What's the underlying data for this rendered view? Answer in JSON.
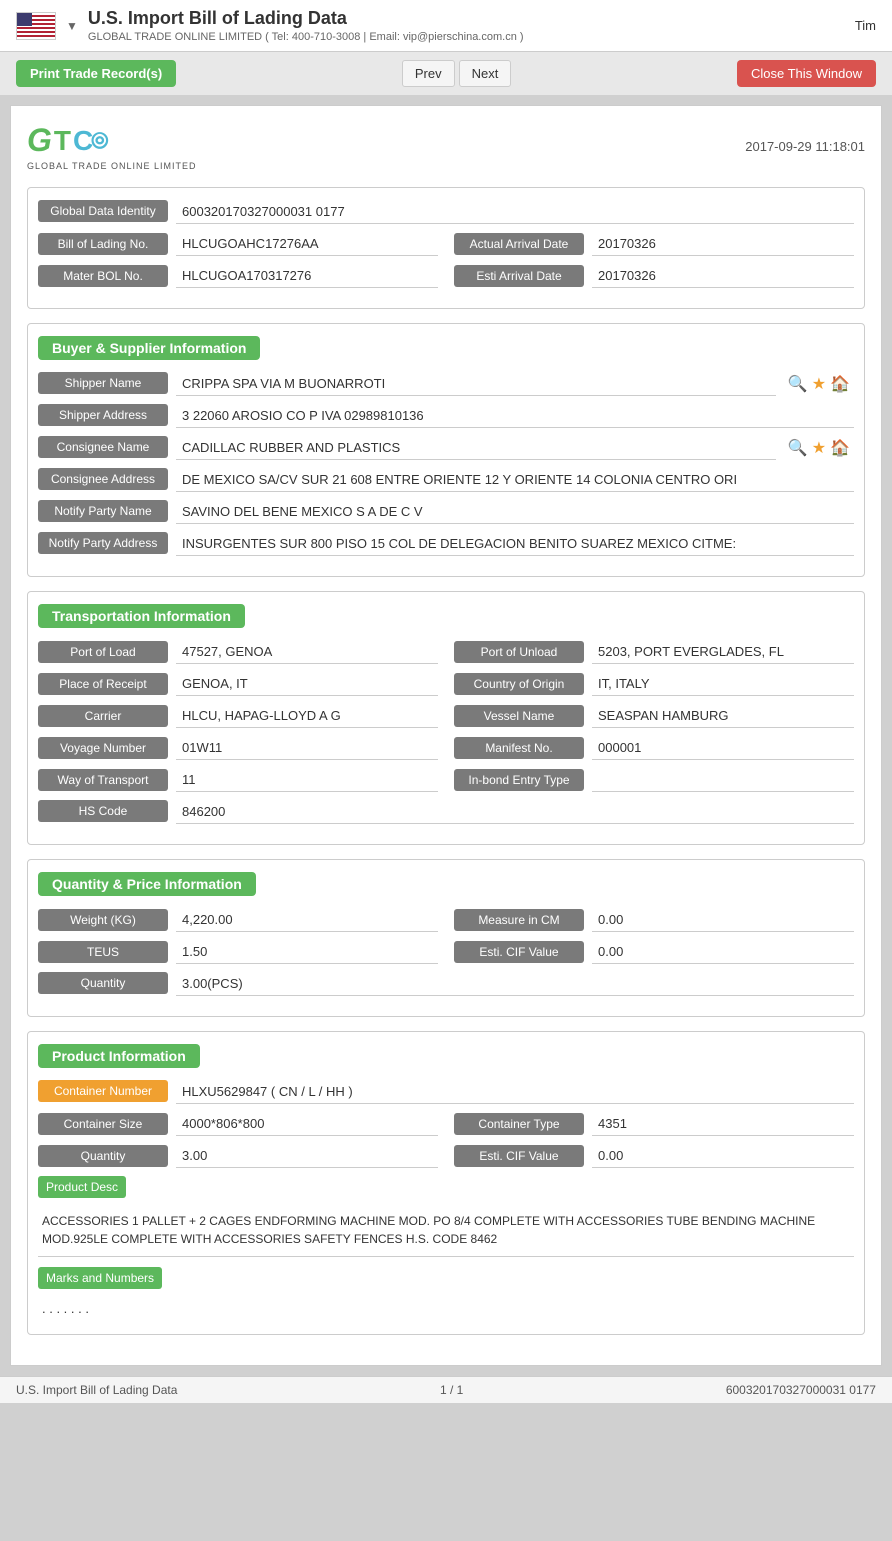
{
  "topBar": {
    "title": "U.S. Import Bill of Lading Data",
    "subtitle": "GLOBAL TRADE ONLINE LIMITED ( Tel: 400-710-3008 | Email: vip@pierschina.com.cn )",
    "rightText": "Tim",
    "dropdownSymbol": "▼"
  },
  "actionBar": {
    "printLabel": "Print Trade Record(s)",
    "prevLabel": "Prev",
    "nextLabel": "Next",
    "closeLabel": "Close This Window"
  },
  "record": {
    "date": "2017-09-29 11:18:01",
    "logoText": "GTC",
    "logoSubtitle": "GLOBAL TRADE ONLINE LIMITED",
    "globalDataIdentity": "600320170327000031 0177",
    "billOfLadingNo": "HLCUGOAHC17276AA",
    "masterBolNo": "HLCUGOA170317276",
    "actualArrivalDate": "20170326",
    "estiArrivalDate": "20170326"
  },
  "buyerSupplier": {
    "sectionTitle": "Buyer & Supplier Information",
    "shipperName": "CRIPPA SPA VIA M BUONARROTI",
    "shipperAddress": "3 22060 AROSIO CO P IVA 02989810136",
    "consigneeName": "CADILLAC RUBBER AND PLASTICS",
    "consigneeAddress": "DE MEXICO SA/CV SUR 21 608 ENTRE ORIENTE 12 Y ORIENTE 14 COLONIA CENTRO ORI",
    "notifyPartyName": "SAVINO DEL BENE MEXICO S A DE C V",
    "notifyPartyAddress": "INSURGENTES SUR 800 PISO 15 COL DE DELEGACION BENITO SUAREZ MEXICO CITME:"
  },
  "transportation": {
    "sectionTitle": "Transportation Information",
    "portOfLoad": "47527, GENOA",
    "portOfUnload": "5203, PORT EVERGLADES, FL",
    "placeOfReceipt": "GENOA, IT",
    "countryOfOrigin": "IT, ITALY",
    "carrier": "HLCU, HAPAG-LLOYD A G",
    "vesselName": "SEASPAN HAMBURG",
    "voyageNumber": "01W11",
    "manifestNo": "000001",
    "wayOfTransport": "11",
    "inBondEntryType": "",
    "hsCode": "846200"
  },
  "quantityPrice": {
    "sectionTitle": "Quantity & Price Information",
    "weightKG": "4,220.00",
    "measureInCM": "0.00",
    "teus": "1.50",
    "estiCIFValue1": "0.00",
    "quantity": "3.00(PCS)"
  },
  "product": {
    "sectionTitle": "Product Information",
    "containerNumber": "HLXU5629847 ( CN / L / HH )",
    "containerSize": "4000*806*800",
    "containerType": "4351",
    "quantity": "3.00",
    "estiCIFValue": "0.00",
    "productDesc": "ACCESSORIES 1 PALLET + 2 CAGES ENDFORMING MACHINE MOD. PO 8/4 COMPLETE WITH ACCESSORIES TUBE BENDING MACHINE MOD.925LE COMPLETE WITH ACCESSORIES SAFETY FENCES H.S. CODE 8462",
    "marksAndNumbers": ". . . . . . ."
  },
  "footer": {
    "left": "U.S. Import Bill of Lading Data",
    "center": "1 / 1",
    "right": "600320170327000031 0177"
  },
  "labels": {
    "globalDataIdentity": "Global Data Identity",
    "billOfLadingNo": "Bill of Lading No.",
    "masterBolNo": "Mater BOL No.",
    "actualArrivalDate": "Actual Arrival Date",
    "estiArrivalDate": "Esti Arrival Date",
    "shipperName": "Shipper Name",
    "shipperAddress": "Shipper Address",
    "consigneeName": "Consignee Name",
    "consigneeAddress": "Consignee Address",
    "notifyPartyName": "Notify Party Name",
    "notifyPartyAddress": "Notify Party Address",
    "portOfLoad": "Port of Load",
    "portOfUnload": "Port of Unload",
    "placeOfReceipt": "Place of Receipt",
    "countryOfOrigin": "Country of Origin",
    "carrier": "Carrier",
    "vesselName": "Vessel Name",
    "voyageNumber": "Voyage Number",
    "manifestNo": "Manifest No.",
    "wayOfTransport": "Way of Transport",
    "inBondEntryType": "In-bond Entry Type",
    "hsCode": "HS Code",
    "weightKG": "Weight (KG)",
    "measureInCM": "Measure in CM",
    "teus": "TEUS",
    "estiCIFValue1": "Esti. CIF Value",
    "quantity": "Quantity",
    "containerNumber": "Container Number",
    "containerSize": "Container Size",
    "containerType": "Container Type",
    "productQuantity": "Quantity",
    "productEstiCIF": "Esti. CIF Value",
    "productDesc": "Product Desc",
    "marksAndNumbers": "Marks and Numbers"
  }
}
